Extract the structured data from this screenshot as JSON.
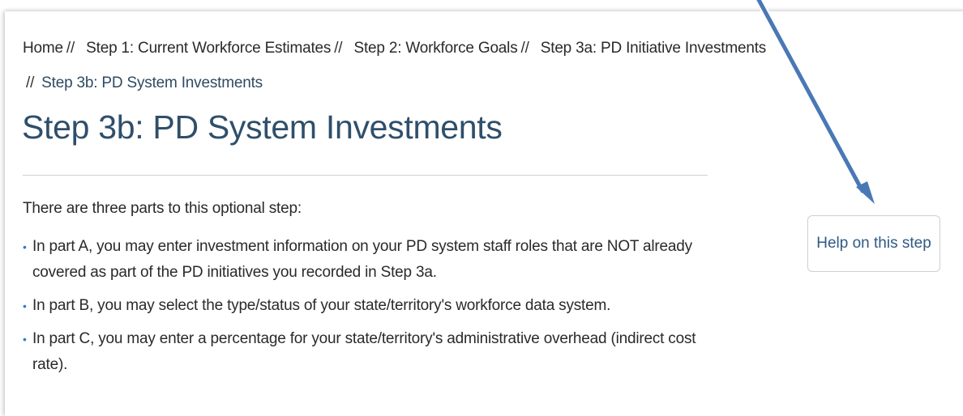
{
  "breadcrumb": {
    "separator": "//",
    "items": [
      {
        "label": "Home"
      },
      {
        "label": "Step 1: Current Workforce Estimates"
      },
      {
        "label": "Step 2: Workforce Goals"
      },
      {
        "label": "Step 3a: PD Initiative Investments"
      },
      {
        "label": "Step 3b: PD System Investments"
      }
    ]
  },
  "page": {
    "title": "Step 3b: PD System Investments",
    "intro": "There are three parts to this optional step:",
    "bullet_icon": "bullet-dot",
    "bullets": [
      "In part A, you may enter investment information on your PD system staff roles that are NOT already covered as part of the PD initiatives you recorded in Step 3a.",
      "In part B, you may select the type/status of your state/territory's workforce data system.",
      "In part C, you may enter a percentage for your state/territory's administrative overhead (indirect cost rate)."
    ]
  },
  "help": {
    "button_label": "Help on this step"
  },
  "annotation": {
    "icon": "pointer-arrow",
    "color": "#4a78b5"
  }
}
